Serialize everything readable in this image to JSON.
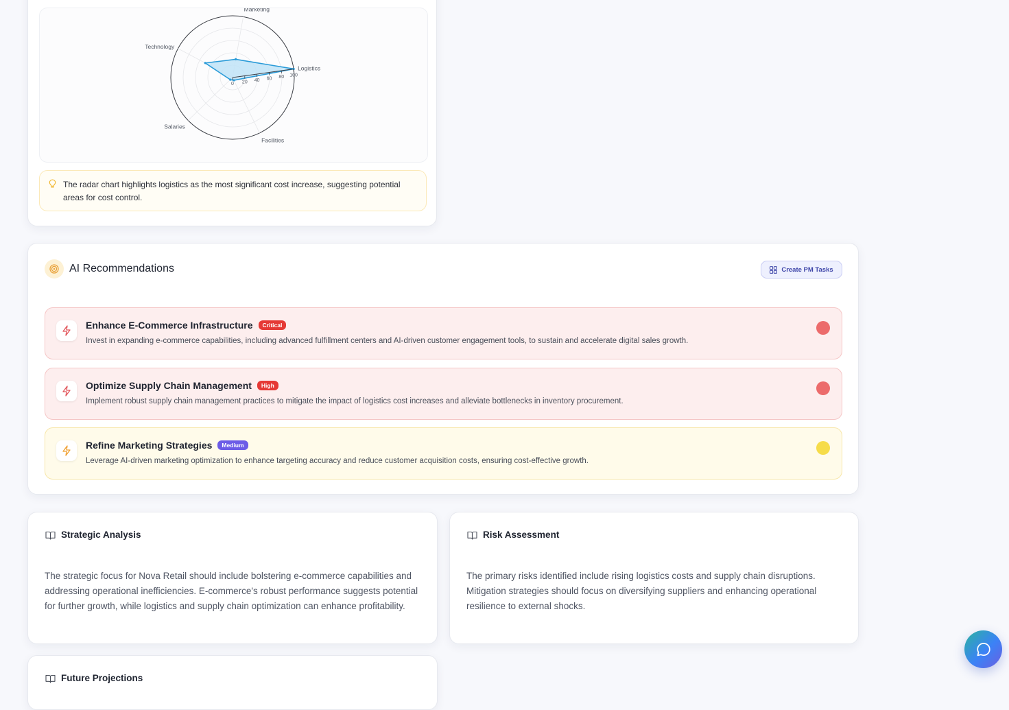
{
  "cost_radar": {
    "insight": "The radar chart highlights logistics as the most significant cost increase, suggesting potential areas for cost control."
  },
  "chart_data": {
    "type": "radar",
    "categories": [
      "Marketing",
      "Logistics",
      "Facilities",
      "Salaries",
      "Technology"
    ],
    "values": [
      30,
      100,
      5,
      5,
      50
    ],
    "radial_ticks": [
      "0",
      "20",
      "40",
      "60",
      "80",
      "100"
    ],
    "rlim": [
      0,
      100
    ],
    "fill_color": "#bfe3f7",
    "line_color": "#2a9bd8"
  },
  "recommendations": {
    "title": "AI Recommendations",
    "create_tasks_label": "Create PM Tasks",
    "items": [
      {
        "title": "Enhance E-Commerce Infrastructure",
        "badge": "Critical",
        "badge_color": "#e53935",
        "dot_color": "#ec6b6b",
        "description": "Invest in expanding e-commerce capabilities, including advanced fulfillment centers and AI-driven customer engagement tools, to sustain and accelerate digital sales growth."
      },
      {
        "title": "Optimize Supply Chain Management",
        "badge": "High",
        "badge_color": "#e53935",
        "dot_color": "#ec6b6b",
        "description": "Implement robust supply chain management practices to mitigate the impact of logistics cost increases and alleviate bottlenecks in inventory procurement."
      },
      {
        "title": "Refine Marketing Strategies",
        "badge": "Medium",
        "badge_color": "#6c5ce7",
        "dot_color": "#f6dc4a",
        "description": "Leverage AI-driven marketing optimization to enhance targeting accuracy and reduce customer acquisition costs, ensuring cost-effective growth."
      }
    ]
  },
  "strategic": {
    "title": "Strategic Analysis",
    "body": "The strategic focus for Nova Retail should include bolstering e-commerce capabilities and addressing operational inefficiencies. E-commerce's robust performance suggests potential for further growth, while logistics and supply chain optimization can enhance profitability."
  },
  "risk": {
    "title": "Risk Assessment",
    "body": "The primary risks identified include rising logistics costs and supply chain disruptions. Mitigation strategies should focus on diversifying suppliers and enhancing operational resilience to external shocks."
  },
  "future": {
    "title": "Future Projections"
  }
}
